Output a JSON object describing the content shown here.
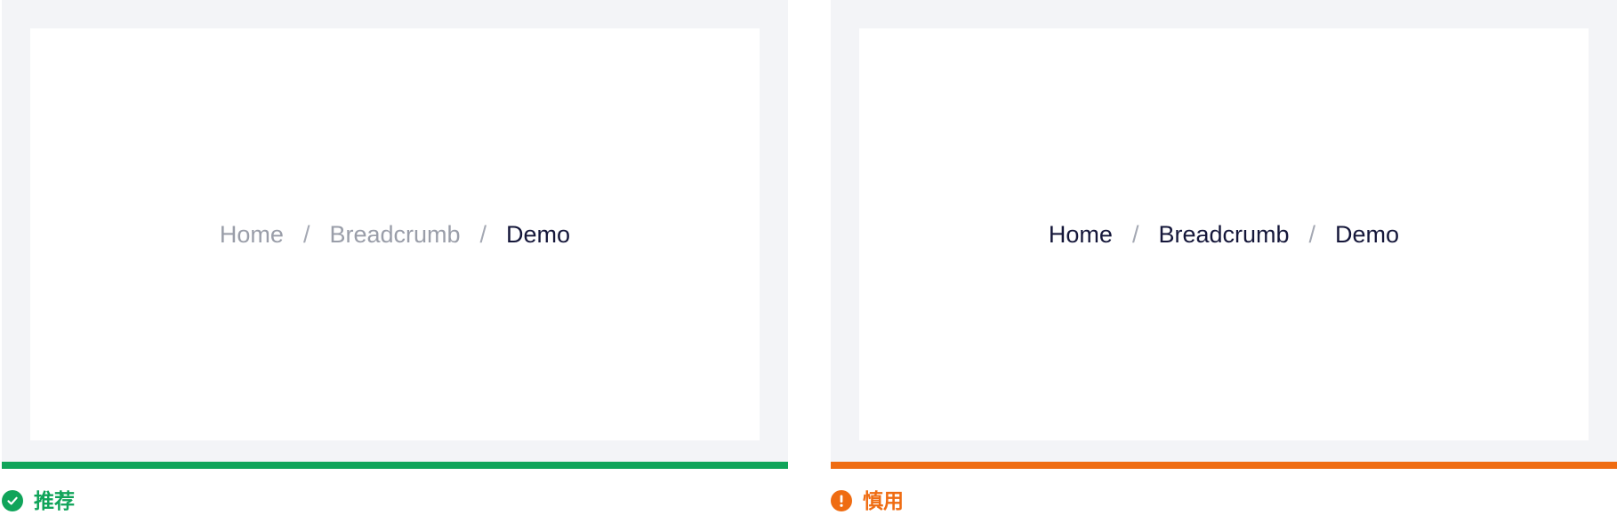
{
  "colors": {
    "panel_background": "#f3f4f7",
    "canvas_background": "#ffffff",
    "recommended": "#10a45a",
    "caution": "#ef6c12",
    "text_primary": "#15173a",
    "text_muted": "#9a9ea9"
  },
  "examples": [
    {
      "breadcrumb": {
        "items": [
          "Home",
          "Breadcrumb",
          "Demo"
        ],
        "separator": "/"
      },
      "verdict": {
        "label": "推荐",
        "icon": "check-circle-icon"
      }
    },
    {
      "breadcrumb": {
        "items": [
          "Home",
          "Breadcrumb",
          "Demo"
        ],
        "separator": "/"
      },
      "verdict": {
        "label": "慎用",
        "icon": "exclamation-circle-icon"
      }
    }
  ]
}
